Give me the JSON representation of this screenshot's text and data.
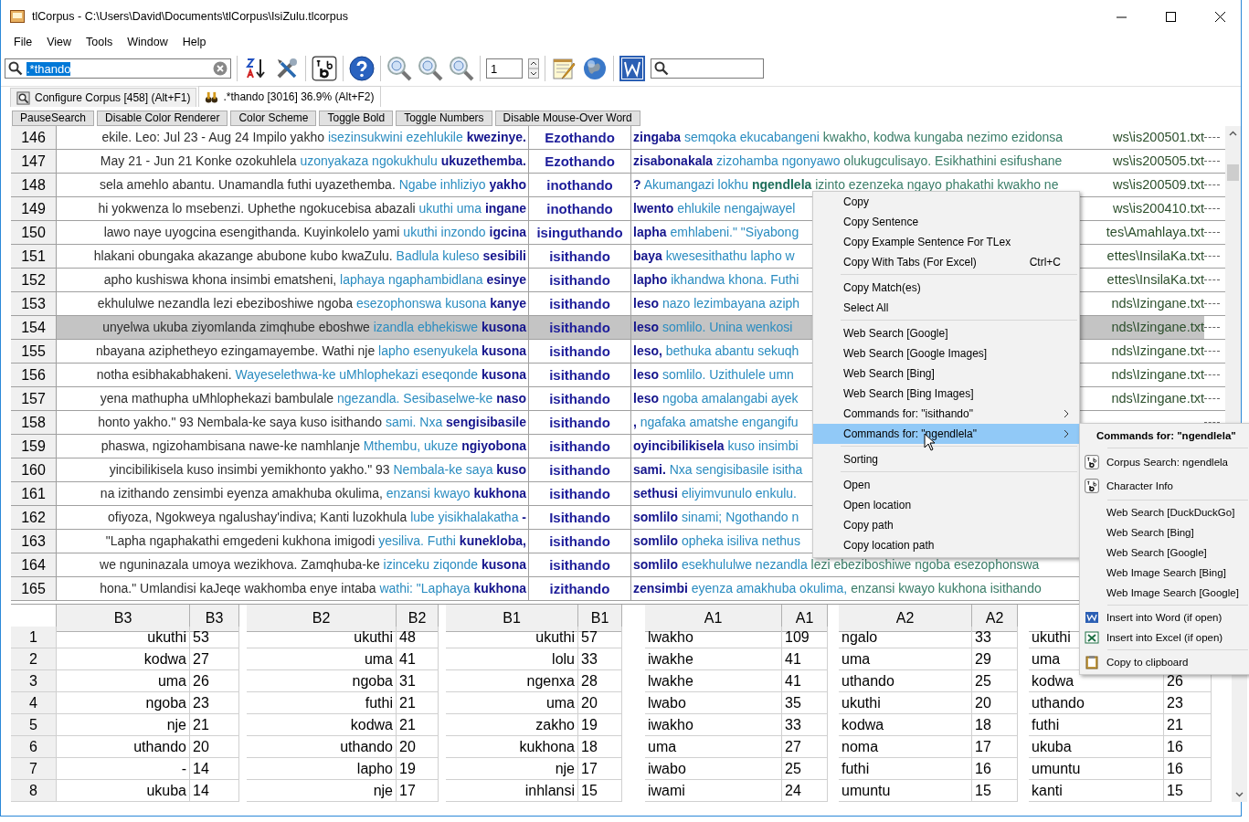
{
  "window": {
    "title": "tlCorpus - C:\\Users\\David\\Documents\\tlCorpus\\IsiZulu.tlcorpus"
  },
  "menu_bar": [
    "File",
    "View",
    "Tools",
    "Window",
    "Help"
  ],
  "toolbar": {
    "search": {
      "value": ".*thando",
      "selected": true
    },
    "spin_value": "1"
  },
  "tabs": [
    {
      "label": "Configure Corpus [458] (Alt+F1)",
      "kind": "configure",
      "selected": false
    },
    {
      "label": ".*thando [3016] 36.9% (Alt+F2)",
      "kind": "search",
      "selected": true
    }
  ],
  "buttons": [
    "PauseSearch",
    "Disable Color Renderer",
    "Color Scheme",
    "Toggle Bold",
    "Toggle Numbers",
    "Disable Mouse-Over Word"
  ],
  "rows": [
    {
      "line": "146",
      "selected": false,
      "left": [
        {
          "text": "ekile. Leo: Jul 23 - Aug 24 Impilo yakho",
          "kind": "far"
        },
        {
          "text": "isezinsukwini ezehlukile",
          "kind": "near"
        },
        {
          "text": "kwezinye.",
          "kind": "match"
        }
      ],
      "keyword": "Ezothando",
      "right": [
        {
          "text": "zingaba",
          "kind": "match"
        },
        {
          "text": "semqoka ekucabangeni",
          "kind": "near"
        },
        {
          "text": "kwakho, kodwa kungaba nezimo ezidonsa",
          "kind": "far"
        }
      ],
      "path": "ws\\is200501.txt"
    },
    {
      "line": "147",
      "selected": false,
      "left": [
        {
          "text": "May 21 - Jun 21 Konke ozokuhlela",
          "kind": "far"
        },
        {
          "text": "uzonyakaza ngokukhulu",
          "kind": "near"
        },
        {
          "text": "ukuzethemba.",
          "kind": "match"
        }
      ],
      "keyword": "Ezothando",
      "right": [
        {
          "text": "zisabonakala",
          "kind": "match"
        },
        {
          "text": "zizohamba ngonyawo",
          "kind": "near"
        },
        {
          "text": "olukugculisayo. Esikhathini esifushane",
          "kind": "far"
        }
      ],
      "path": "ws\\is200505.txt"
    },
    {
      "line": "148",
      "selected": false,
      "left": [
        {
          "text": "sela amehlo abantu. Unamandla futhi uyazethemba.",
          "kind": "far"
        },
        {
          "text": "Ngabe inhliziyo",
          "kind": "near"
        },
        {
          "text": "yakho",
          "kind": "match"
        }
      ],
      "keyword": "inothando",
      "right": [
        {
          "text": "?",
          "kind": "match"
        },
        {
          "text": "Akumangazi lokhu",
          "kind": "near"
        },
        {
          "text": "ngendlela",
          "kind": "hover"
        },
        {
          "text": "izinto ezenzeka ngayo phakathi kwakho ne",
          "kind": "far"
        }
      ],
      "path": "ws\\is200509.txt"
    },
    {
      "line": "149",
      "selected": false,
      "left": [
        {
          "text": "hi yokwenza lo msebenzi. Uphethe ngokucebisa abazali",
          "kind": "far"
        },
        {
          "text": "ukuthi uma",
          "kind": "near"
        },
        {
          "text": "ingane",
          "kind": "match"
        }
      ],
      "keyword": "inothando",
      "right": [
        {
          "text": "lwento",
          "kind": "match"
        },
        {
          "text": "ehlukile nengajwayel",
          "kind": "near"
        }
      ],
      "path": "ws\\is200410.txt"
    },
    {
      "line": "150",
      "selected": false,
      "left": [
        {
          "text": "lawo naye uyogcina esengithanda. Kuyinkolelo yami",
          "kind": "far"
        },
        {
          "text": "ukuthi inzondo",
          "kind": "near"
        },
        {
          "text": "igcina",
          "kind": "match"
        }
      ],
      "keyword": "isinguthando",
      "right": [
        {
          "text": "lapha",
          "kind": "match"
        },
        {
          "text": "emhlabeni.\" \"Siyabong",
          "kind": "near"
        }
      ],
      "path": "tes\\Amahlaya.txt"
    },
    {
      "line": "151",
      "selected": false,
      "left": [
        {
          "text": "hlakani obungaka akazange abubone kubo kwaZulu.",
          "kind": "far"
        },
        {
          "text": "Badlula kuleso",
          "kind": "near"
        },
        {
          "text": "sesibili",
          "kind": "match"
        }
      ],
      "keyword": "isithando",
      "right": [
        {
          "text": "baya",
          "kind": "match"
        },
        {
          "text": "kwesesithathu lapho w",
          "kind": "near"
        }
      ],
      "path": "ettes\\InsilaKa.txt"
    },
    {
      "line": "152",
      "selected": false,
      "left": [
        {
          "text": "apho kushiswa khona insimbi ematsheni,",
          "kind": "far"
        },
        {
          "text": "laphaya ngaphambidlana",
          "kind": "near"
        },
        {
          "text": "esinye",
          "kind": "match"
        }
      ],
      "keyword": "isithando",
      "right": [
        {
          "text": "lapho",
          "kind": "match"
        },
        {
          "text": "ikhandwa khona. Futhi",
          "kind": "near"
        }
      ],
      "path": "ettes\\InsilaKa.txt"
    },
    {
      "line": "153",
      "selected": false,
      "left": [
        {
          "text": "ekhululwe nezandla lezi ebeziboshiwe ngoba",
          "kind": "far"
        },
        {
          "text": "esezophonswa kusona",
          "kind": "near"
        },
        {
          "text": "kanye",
          "kind": "match"
        }
      ],
      "keyword": "isithando",
      "right": [
        {
          "text": "leso",
          "kind": "match"
        },
        {
          "text": "nazo lezimbayana aziph",
          "kind": "near"
        }
      ],
      "path": "nds\\Izingane.txt"
    },
    {
      "line": "154",
      "selected": true,
      "left": [
        {
          "text": "unyelwa ukuba ziyomlanda zimqhube eboshwe",
          "kind": "far"
        },
        {
          "text": "izandla ebhekiswe",
          "kind": "near"
        },
        {
          "text": "kusona",
          "kind": "match"
        }
      ],
      "keyword": "isithando",
      "right": [
        {
          "text": "leso",
          "kind": "match"
        },
        {
          "text": "somlilo. Unina wenkosi",
          "kind": "near"
        }
      ],
      "path": "nds\\Izingane.txt"
    },
    {
      "line": "155",
      "selected": false,
      "left": [
        {
          "text": "nbayana aziphetheyo ezingamayembe. Wathi nje",
          "kind": "far"
        },
        {
          "text": "lapho esenyukela",
          "kind": "near"
        },
        {
          "text": "kusona",
          "kind": "match"
        }
      ],
      "keyword": "isithando",
      "right": [
        {
          "text": "leso,",
          "kind": "match"
        },
        {
          "text": "bethuka abantu sekuqh",
          "kind": "near"
        }
      ],
      "path": "nds\\Izingane.txt"
    },
    {
      "line": "156",
      "selected": false,
      "left": [
        {
          "text": "notha esibhakabhakeni.",
          "kind": "far"
        },
        {
          "text": "Wayeselethwa-ke uMhlophekazi eseqonde",
          "kind": "near"
        },
        {
          "text": "kusona",
          "kind": "match"
        }
      ],
      "keyword": "isithando",
      "right": [
        {
          "text": "leso",
          "kind": "match"
        },
        {
          "text": "somlilo. Uzithulele umn",
          "kind": "near"
        }
      ],
      "path": "nds\\Izingane.txt"
    },
    {
      "line": "157",
      "selected": false,
      "left": [
        {
          "text": "yena mathupha uMhlophekazi bambulale",
          "kind": "far"
        },
        {
          "text": "ngezandla. Sesibaselwe-ke",
          "kind": "near"
        },
        {
          "text": "naso",
          "kind": "match"
        }
      ],
      "keyword": "isithando",
      "right": [
        {
          "text": "leso",
          "kind": "match"
        },
        {
          "text": "ngoba amalangabi ayek",
          "kind": "near"
        }
      ],
      "path": "nds\\Izingane.txt"
    },
    {
      "line": "158",
      "selected": false,
      "left": [
        {
          "text": "honto yakho.\" 93 Nembala-ke saya kuso isithando",
          "kind": "far"
        },
        {
          "text": "sami. Nxa",
          "kind": "near"
        },
        {
          "text": "sengisibasile",
          "kind": "match"
        }
      ],
      "keyword": "isithando",
      "right": [
        {
          "text": ",",
          "kind": "match"
        },
        {
          "text": "ngafaka amatshe engangifu",
          "kind": "near"
        }
      ]
    },
    {
      "line": "159",
      "selected": false,
      "left": [
        {
          "text": "phaswa, ngizohambisana nawe-ke namhlanje",
          "kind": "far"
        },
        {
          "text": "Mthembu, ukuze",
          "kind": "near"
        },
        {
          "text": "ngiyobona",
          "kind": "match"
        }
      ],
      "keyword": "isithando",
      "right": [
        {
          "text": "oyincibilikisela",
          "kind": "match"
        },
        {
          "text": "kuso insimbi",
          "kind": "near"
        }
      ]
    },
    {
      "line": "160",
      "selected": false,
      "left": [
        {
          "text": "yincibilikisela kuso insimbi yemikhonto yakho.\" 93",
          "kind": "far"
        },
        {
          "text": "Nembala-ke saya",
          "kind": "near"
        },
        {
          "text": "kuso",
          "kind": "match"
        }
      ],
      "keyword": "isithando",
      "right": [
        {
          "text": "sami.",
          "kind": "match"
        },
        {
          "text": "Nxa sengisibasile isitha",
          "kind": "near"
        }
      ]
    },
    {
      "line": "161",
      "selected": false,
      "left": [
        {
          "text": "na izithando zensimbi eyenza amakhuba okulima,",
          "kind": "far"
        },
        {
          "text": "enzansi kwayo",
          "kind": "near"
        },
        {
          "text": "kukhona",
          "kind": "match"
        }
      ],
      "keyword": "isithando",
      "right": [
        {
          "text": "sethusi",
          "kind": "match"
        },
        {
          "text": "eliyimvunulo enkulu.",
          "kind": "near"
        }
      ]
    },
    {
      "line": "162",
      "selected": false,
      "left": [
        {
          "text": "ofiyoza, Ngokweya ngalushay'indiva; Kanti luzokhula",
          "kind": "far"
        },
        {
          "text": "lube yisikhalakatha",
          "kind": "near"
        },
        {
          "text": "-",
          "kind": "match"
        }
      ],
      "keyword": "Isithando",
      "right": [
        {
          "text": "somlilo",
          "kind": "match"
        },
        {
          "text": "sinami; Ngothando n",
          "kind": "near"
        }
      ]
    },
    {
      "line": "163",
      "selected": false,
      "left": [
        {
          "text": "\"Lapha ngaphakathi emgedeni kukhona imigodi",
          "kind": "far"
        },
        {
          "text": "yesiliva. Futhi",
          "kind": "near"
        },
        {
          "text": "kunekloba,",
          "kind": "match"
        }
      ],
      "keyword": "isithando",
      "right": [
        {
          "text": "somlilo",
          "kind": "match"
        },
        {
          "text": "opheka isiliva nethus",
          "kind": "near"
        }
      ]
    },
    {
      "line": "164",
      "selected": false,
      "left": [
        {
          "text": "we nguninazala umoya wezikhova. Zamqhuba-ke",
          "kind": "far"
        },
        {
          "text": "izinceku ziqonde",
          "kind": "near"
        },
        {
          "text": "kusona",
          "kind": "match"
        }
      ],
      "keyword": "isithando",
      "right": [
        {
          "text": "somlilo",
          "kind": "match"
        },
        {
          "text": "esekhululwe nezandla",
          "kind": "near"
        },
        {
          "text": "lezi ebeziboshiwe ngoba esezophonswa",
          "kind": "far"
        }
      ]
    },
    {
      "line": "165",
      "selected": false,
      "left": [
        {
          "text": "hona.\" Umlandisi kaJeqe wakhomba enye intaba",
          "kind": "far"
        },
        {
          "text": "wathi: \"Laphaya",
          "kind": "near"
        },
        {
          "text": "kukhona",
          "kind": "match"
        }
      ],
      "keyword": "izithando",
      "right": [
        {
          "text": "zensimbi",
          "kind": "match"
        },
        {
          "text": "eyenza amakhuba okulima,",
          "kind": "near"
        },
        {
          "text": "enzansi kwayo kukhona isithando",
          "kind": "far"
        }
      ]
    }
  ],
  "collocates": {
    "row_numbers": [
      "1",
      "2",
      "3",
      "4",
      "5",
      "6",
      "7",
      "8"
    ],
    "groups": [
      {
        "word_header": "B3",
        "count_header": "B3",
        "rows": [
          {
            "word": "ukuthi",
            "count": "53"
          },
          {
            "word": "kodwa",
            "count": "27"
          },
          {
            "word": "uma",
            "count": "26"
          },
          {
            "word": "ngoba",
            "count": "23"
          },
          {
            "word": "nje",
            "count": "21"
          },
          {
            "word": "uthando",
            "count": "20"
          },
          {
            "word": "-",
            "count": "14"
          },
          {
            "word": "ukuba",
            "count": "14"
          }
        ]
      },
      {
        "word_header": "B2",
        "count_header": "B2",
        "rows": [
          {
            "word": "ukuthi",
            "count": "48"
          },
          {
            "word": "uma",
            "count": "41"
          },
          {
            "word": "ngoba",
            "count": "31"
          },
          {
            "word": "futhi",
            "count": "21"
          },
          {
            "word": "kodwa",
            "count": "21"
          },
          {
            "word": "uthando",
            "count": "20"
          },
          {
            "word": "lapho",
            "count": "19"
          },
          {
            "word": "nje",
            "count": "17"
          }
        ]
      },
      {
        "word_header": "B1",
        "count_header": "B1",
        "rows": [
          {
            "word": "ukuthi",
            "count": "57"
          },
          {
            "word": "lolu",
            "count": "33"
          },
          {
            "word": "ngenxa",
            "count": "28"
          },
          {
            "word": "uma",
            "count": "20"
          },
          {
            "word": "zakho",
            "count": "19"
          },
          {
            "word": "kukhona",
            "count": "18"
          },
          {
            "word": "nje",
            "count": "17"
          },
          {
            "word": "inhlansi",
            "count": "15"
          }
        ]
      },
      {
        "word_header": "A1",
        "count_header": "A1",
        "rows": [
          {
            "word": "lwakho",
            "count": "109"
          },
          {
            "word": "iwakhe",
            "count": "41"
          },
          {
            "word": "lwakhe",
            "count": "41"
          },
          {
            "word": "lwabo",
            "count": "35"
          },
          {
            "word": "iwakho",
            "count": "33"
          },
          {
            "word": "uma",
            "count": "27"
          },
          {
            "word": "iwabo",
            "count": "25"
          },
          {
            "word": "iwami",
            "count": "24"
          }
        ]
      },
      {
        "word_header": "A2",
        "count_header": "A2",
        "rows": [
          {
            "word": "ngalo",
            "count": "33"
          },
          {
            "word": "uma",
            "count": "29"
          },
          {
            "word": "uthando",
            "count": "25"
          },
          {
            "word": "ukuthi",
            "count": "20"
          },
          {
            "word": "kodwa",
            "count": "18"
          },
          {
            "word": "noma",
            "count": "17"
          },
          {
            "word": "futhi",
            "count": "16"
          },
          {
            "word": "umuntu",
            "count": "15"
          }
        ]
      },
      {
        "rows": [
          {
            "word": "ukuthi"
          },
          {
            "word": "uma"
          },
          {
            "word": "kodwa",
            "count": "26"
          },
          {
            "word": "uthando",
            "count": "23"
          },
          {
            "word": "futhi",
            "count": "21"
          },
          {
            "word": "ukuba",
            "count": "16"
          },
          {
            "word": "umuntu",
            "count": "16"
          },
          {
            "word": "kanti",
            "count": "15"
          }
        ]
      }
    ]
  },
  "context_menu": {
    "items": [
      {
        "kind": "item",
        "label": "Copy",
        "selected": false
      },
      {
        "kind": "item",
        "label": "Copy Sentence",
        "selected": false
      },
      {
        "kind": "item",
        "label": "Copy Example Sentence For TLex",
        "selected": false
      },
      {
        "kind": "item",
        "label": "Copy With Tabs (For Excel)",
        "shortcut": "Ctrl+C",
        "selected": false
      },
      {
        "kind": "separator"
      },
      {
        "kind": "item",
        "label": "Copy Match(es)",
        "selected": false
      },
      {
        "kind": "item",
        "label": "Select All",
        "selected": false
      },
      {
        "kind": "separator"
      },
      {
        "kind": "item",
        "label": "Web Search [Google]",
        "selected": false
      },
      {
        "kind": "item",
        "label": "Web Search [Google Images]",
        "selected": false
      },
      {
        "kind": "item",
        "label": "Web Search [Bing]",
        "selected": false
      },
      {
        "kind": "item",
        "label": "Web Search [Bing Images]",
        "selected": false
      },
      {
        "kind": "item",
        "label": "Commands for: \"isithando\"",
        "submenu": true,
        "selected": false
      },
      {
        "kind": "item",
        "label": "Commands for: \"ngendlela\"",
        "submenu": true,
        "selected": true
      },
      {
        "kind": "separator"
      },
      {
        "kind": "item",
        "label": "Sorting",
        "selected": false
      },
      {
        "kind": "separator"
      },
      {
        "kind": "item",
        "label": "Open",
        "selected": false
      },
      {
        "kind": "item",
        "label": "Open location",
        "selected": false
      },
      {
        "kind": "item",
        "label": "Copy path",
        "selected": false
      },
      {
        "kind": "item",
        "label": "Copy location path",
        "selected": false
      }
    ]
  },
  "submenu": {
    "title": "Commands for: \"ngendlela\"",
    "items": [
      {
        "kind": "separator"
      },
      {
        "kind": "abc",
        "label": "Corpus Search: ngendlela"
      },
      {
        "kind": "abc",
        "label": "Character Info"
      },
      {
        "kind": "separator"
      },
      {
        "kind": "item",
        "label": "Web Search [DuckDuckGo]"
      },
      {
        "kind": "item",
        "label": "Web Search [Bing]"
      },
      {
        "kind": "item",
        "label": "Web Search [Google]"
      },
      {
        "kind": "item",
        "label": "Web Image Search [Bing]"
      },
      {
        "kind": "item",
        "label": "Web Image Search [Google]"
      },
      {
        "kind": "separator"
      },
      {
        "kind": "word",
        "label": "Insert into Word (if open)"
      },
      {
        "kind": "excel",
        "label": "Insert into Excel (if open)"
      },
      {
        "kind": "separator"
      },
      {
        "kind": "clipboard",
        "label": "Copy to clipboard"
      }
    ]
  }
}
